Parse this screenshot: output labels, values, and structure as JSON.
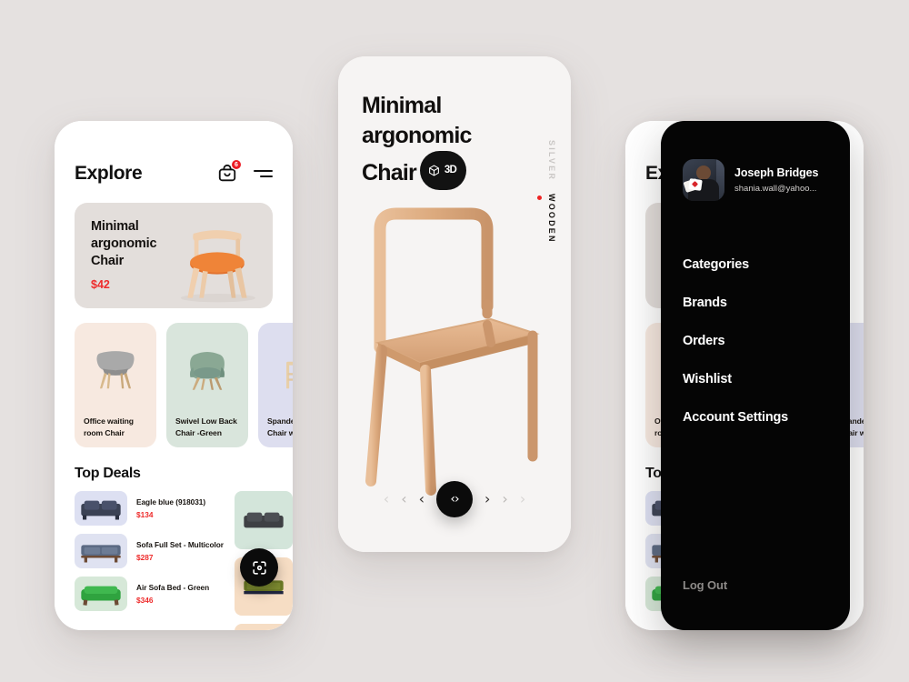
{
  "background_color": "#e5e1e0",
  "accent_red": "#ee2b2b",
  "explore": {
    "title": "Explore",
    "cart_badge": "6",
    "cart_icon": "shopping-bag-icon",
    "menu_icon": "hamburger-menu-icon",
    "hero": {
      "name": "Minimal\nargonomic\nChair",
      "line1": "Minimal",
      "line2": "argonomic",
      "line3": "Chair",
      "price": "$42",
      "bg_color": "#e3dedb"
    },
    "categories": [
      {
        "label": "Office waiting room Chair",
        "bg_color": "#f7e9e0"
      },
      {
        "label": "Swivel Low Back Chair -Green",
        "bg_color": "#d9e5dc"
      },
      {
        "label": "Spandel Office Chair wooden",
        "bg_color": "#dddeef"
      }
    ],
    "deals_title": "Top Deals",
    "deals_left": [
      {
        "name": "Eagle blue (918031)",
        "price": "$134",
        "bg_color": "#dde0f2",
        "sofa_color": "#3b4254"
      },
      {
        "name": "Sofa Full Set - Multicolor",
        "price": "$287",
        "bg_color": "#dfe2f1",
        "sofa_color": "#5b6a83"
      },
      {
        "name": "Air Sofa Bed - Green",
        "price": "$346",
        "bg_color": "#d6e8d8",
        "sofa_color": "#2fa33f"
      }
    ],
    "deals_right": [
      {
        "bg_color": "#d3e5da",
        "sofa_color": "#3e4044"
      },
      {
        "bg_color": "#f6ddc4",
        "sofa_color": "#6d7b25"
      },
      {
        "bg_color": "#f6ddc4",
        "sofa_color": "#8b8f92"
      }
    ],
    "fab_icon": "ar-scan-icon"
  },
  "detail": {
    "title_line1": "Minimal",
    "title_line2": "argonomic",
    "title_line3": "Chair",
    "badge_3d_label": "3D",
    "badge_3d_icon": "cube-3d-icon",
    "material_inactive": "SILVER",
    "material_active": "WOODEN",
    "carousel": {
      "prev_icon": "chevron-left-icon",
      "next_icon": "chevron-right-icon",
      "center_label": "‹›"
    }
  },
  "drawer": {
    "profile_name": "Joseph Bridges",
    "profile_email": "shania.wall@yahoo...",
    "avatar_icon": "user-avatar-photo",
    "items": [
      {
        "label": "Categories"
      },
      {
        "label": "Brands"
      },
      {
        "label": "Orders"
      },
      {
        "label": "Wishlist"
      },
      {
        "label": "Account Settings"
      }
    ],
    "logout_label": "Log Out"
  }
}
